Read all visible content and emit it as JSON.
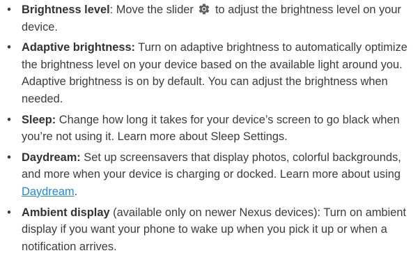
{
  "items": [
    {
      "term": "Brightness level",
      "sep": ":",
      "before_icon": " Move the slider ",
      "icon": "brightness-gear-icon",
      "text": " to adjust the brightness level on your device."
    },
    {
      "term": "Adaptive brightness:",
      "text": " Turn on adaptive brightness to automatically optimize the brightness level on your device based on the available light around you. Adaptive brightness is on by default. You can adjust the brightness when needed."
    },
    {
      "term": "Sleep:",
      "text": " Change how long it takes for your device’s screen to go black when you’re not using it. Learn more about Sleep Settings."
    },
    {
      "term": "Daydream:",
      "text": " Set up screensavers that display photos, colorful backgrounds, and more when your device is charging or docked. Learn more about using ",
      "link": "Daydream",
      "after": "."
    },
    {
      "term": "Ambient display",
      "text": " (available only on newer Nexus devices): Turn on ambient display if you want your phone to wake up when you pick it up or when a notification arrives."
    }
  ],
  "bullet_char": "•",
  "colors": {
    "text": "#3c3c3c",
    "link": "#1e88e5",
    "icon": "#616161"
  }
}
